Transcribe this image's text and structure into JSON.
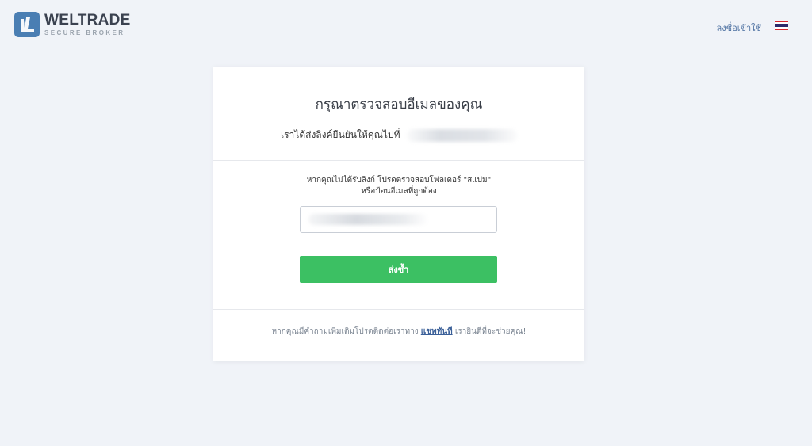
{
  "header": {
    "logo_name": "WELTRADE",
    "logo_tagline": "SECURE BROKER",
    "login_link": "ลงชื่อเข้าใช้",
    "language_flag": "thai-flag-icon"
  },
  "card": {
    "title": "กรุณาตรวจสอบอีเมลของคุณ",
    "sent_text": "เราได้ส่งลิงค์ยืนยันให้คุณไปที่",
    "hint_line1": "หากคุณไม่ได้รับลิงก์ โปรดตรวจสอบโฟลเดอร์ \"สแปม\"",
    "hint_line2": "หรือป้อนอีเมลที่ถูกต้อง",
    "email_input": {
      "value": "",
      "placeholder": ""
    },
    "resend_button": "ส่งซ้ำ",
    "footer_prefix": "หากคุณมีคำถามเพิ่มเติมโปรดติดต่อเราทาง",
    "footer_link": "แชททันที",
    "footer_suffix": "เรายินดีที่จะช่วยคุณ!"
  },
  "colors": {
    "page_background": "#f0f3f8",
    "accent_green": "#3cc063",
    "link_blue": "#4b6fa0",
    "logo_blue": "#4a7eb3"
  }
}
